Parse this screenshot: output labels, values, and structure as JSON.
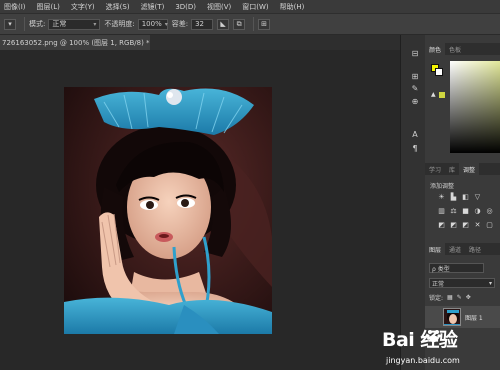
{
  "menubar": {
    "items": [
      "图像(I)",
      "图层(L)",
      "文字(Y)",
      "选择(S)",
      "滤镜(T)",
      "3D(D)",
      "视图(V)",
      "窗口(W)",
      "帮助(H)"
    ]
  },
  "options": {
    "mode_label": "模式:",
    "mode_value": "正常",
    "opacity_label": "不透明度:",
    "opacity_value": "100%",
    "flow_label": "容差:",
    "flow_value": "32"
  },
  "document": {
    "tab_title": "726163052.png @ 100% (图层 1, RGB/8) *",
    "close_glyph": "×"
  },
  "dock": {
    "icons": [
      "character-icon",
      "paragraph-icon",
      "brush-icon",
      "clone-icon",
      "text-a-icon",
      "pilcrow-icon"
    ]
  },
  "panels": {
    "color_tabs": [
      "颜色",
      "色板"
    ],
    "adjust_tabs": [
      "学习",
      "库",
      "调整"
    ],
    "adjust_title": "添加调整",
    "adjust_icons_row1": [
      "☀",
      "▙",
      "◧",
      "▽"
    ],
    "adjust_icons_row2": [
      "▥",
      "⚖",
      "■",
      "◑",
      "◎"
    ],
    "adjust_icons_row3": [
      "◩",
      "◩",
      "◩",
      "✕",
      "▢"
    ],
    "layers_tabs": [
      "图层",
      "通道",
      "路径"
    ],
    "filter_label": "ρ 类型",
    "blend_value": "正常",
    "lock_label": "锁定:",
    "layer_name": "图层 1"
  },
  "watermark": {
    "logo_text": "Bai  经验",
    "url": "jingyan.baidu.com"
  },
  "colors": {
    "accent_fg": "#f2f200",
    "accent_bg": "#ffffff",
    "ui_dark": "#282828"
  }
}
